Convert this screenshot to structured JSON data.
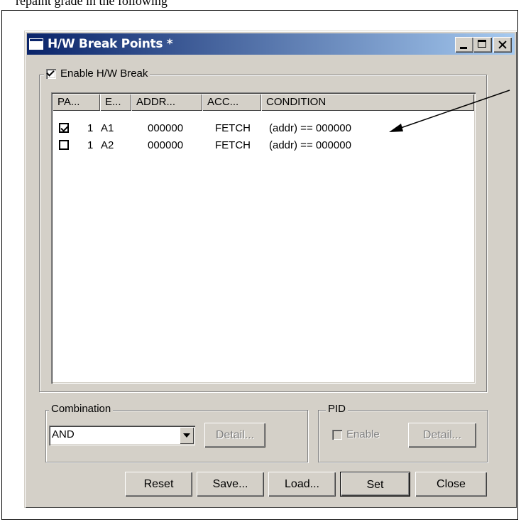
{
  "document": {
    "top_text": "repaint grade in the following"
  },
  "window": {
    "title": "H/W Break Points *",
    "controls": {
      "minimize": "minimize-icon",
      "maximize": "maximize-icon",
      "close": "close-icon"
    }
  },
  "enable_group": {
    "label": "Enable H/W Break",
    "checked": true
  },
  "list": {
    "columns": [
      "PA...",
      "E...",
      "ADDR...",
      "ACC...",
      "CONDITION"
    ],
    "rows": [
      {
        "checked": true,
        "pass": "1",
        "event": "A1",
        "address": "000000",
        "access": "FETCH",
        "condition": "(addr) == 000000"
      },
      {
        "checked": false,
        "pass": "1",
        "event": "A2",
        "address": "000000",
        "access": "FETCH",
        "condition": "(addr) == 000000"
      }
    ]
  },
  "combination": {
    "label": "Combination",
    "selected": "AND",
    "detail_label": "Detail..."
  },
  "pid": {
    "label": "PID",
    "enable_label": "Enable",
    "detail_label": "Detail..."
  },
  "buttons": {
    "reset": "Reset",
    "save": "Save...",
    "load": "Load...",
    "set": "Set",
    "close": "Close"
  }
}
